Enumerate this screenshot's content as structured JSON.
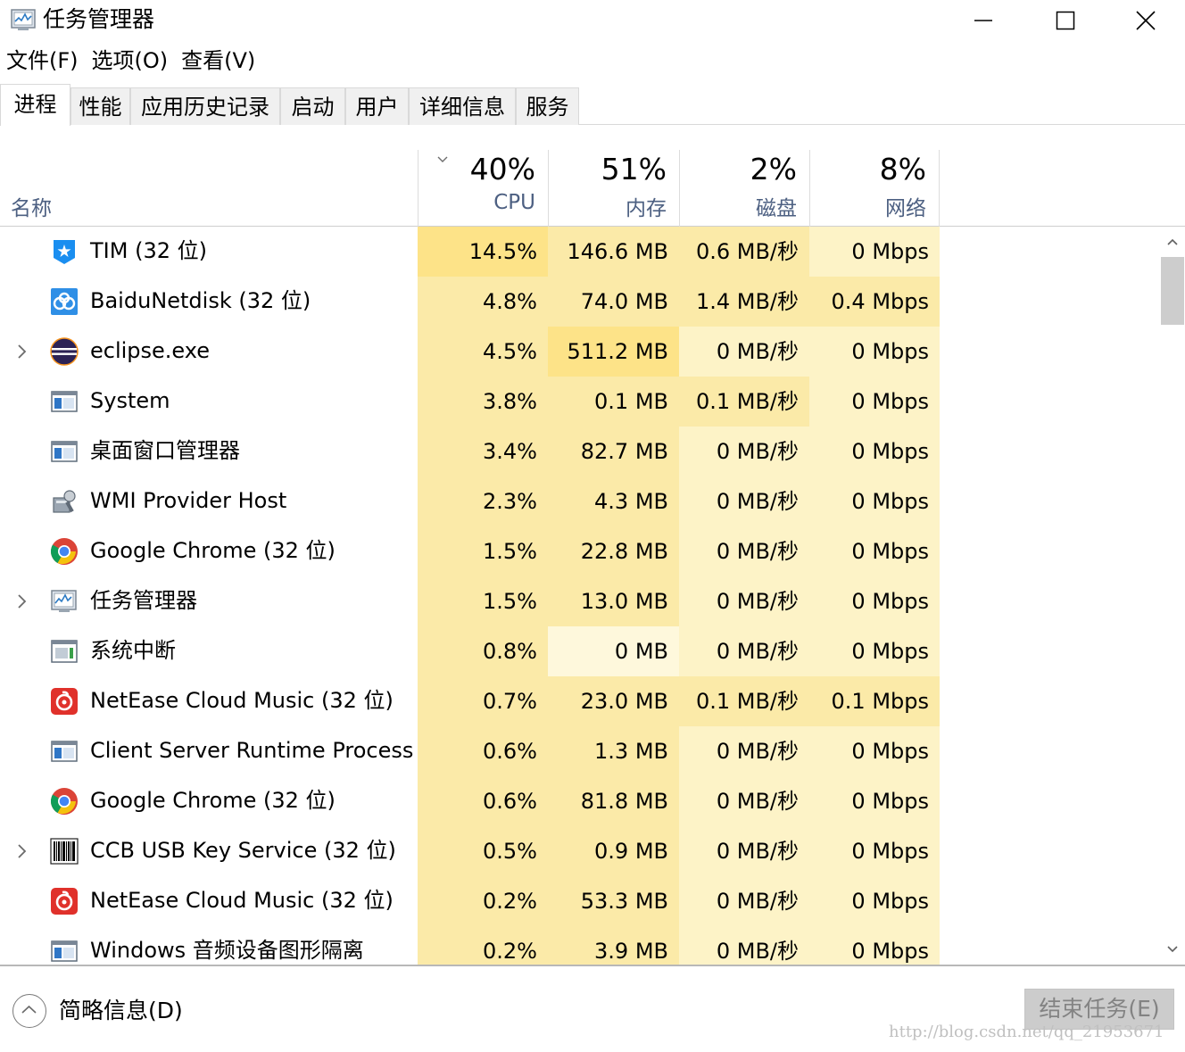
{
  "window": {
    "title": "任务管理器",
    "minimize_icon": "minimize-icon",
    "maximize_icon": "maximize-icon",
    "close_icon": "close-icon"
  },
  "menu": [
    "文件(F)",
    "选项(O)",
    "查看(V)"
  ],
  "tabs": [
    "进程",
    "性能",
    "应用历史记录",
    "启动",
    "用户",
    "详细信息",
    "服务"
  ],
  "active_tab": "进程",
  "columns": {
    "name": "名称",
    "cpu": {
      "percent": "40%",
      "label": "CPU"
    },
    "memory": {
      "percent": "51%",
      "label": "内存"
    },
    "disk": {
      "percent": "2%",
      "label": "磁盘"
    },
    "network": {
      "percent": "8%",
      "label": "网络"
    },
    "sort_column": "CPU"
  },
  "processes": [
    {
      "name": "TIM (32 位)",
      "icon": "tim-icon",
      "expandable": false,
      "cpu": "14.5%",
      "memory": "146.6 MB",
      "disk": "0.6 MB/秒",
      "network": "0 Mbps"
    },
    {
      "name": "BaiduNetdisk (32 位)",
      "icon": "baidu-netdisk-icon",
      "expandable": false,
      "cpu": "4.8%",
      "memory": "74.0 MB",
      "disk": "1.4 MB/秒",
      "network": "0.4 Mbps"
    },
    {
      "name": "eclipse.exe",
      "icon": "eclipse-icon",
      "expandable": true,
      "cpu": "4.5%",
      "memory": "511.2 MB",
      "disk": "0 MB/秒",
      "network": "0 Mbps"
    },
    {
      "name": "System",
      "icon": "system-window-icon",
      "expandable": false,
      "cpu": "3.8%",
      "memory": "0.1 MB",
      "disk": "0.1 MB/秒",
      "network": "0 Mbps"
    },
    {
      "name": "桌面窗口管理器",
      "icon": "system-window-icon",
      "expandable": false,
      "cpu": "3.4%",
      "memory": "82.7 MB",
      "disk": "0 MB/秒",
      "network": "0 Mbps"
    },
    {
      "name": "WMI Provider Host",
      "icon": "wmi-icon",
      "expandable": false,
      "cpu": "2.3%",
      "memory": "4.3 MB",
      "disk": "0 MB/秒",
      "network": "0 Mbps"
    },
    {
      "name": "Google Chrome (32 位)",
      "icon": "chrome-icon",
      "expandable": false,
      "cpu": "1.5%",
      "memory": "22.8 MB",
      "disk": "0 MB/秒",
      "network": "0 Mbps"
    },
    {
      "name": "任务管理器",
      "icon": "task-manager-icon",
      "expandable": true,
      "cpu": "1.5%",
      "memory": "13.0 MB",
      "disk": "0 MB/秒",
      "network": "0 Mbps"
    },
    {
      "name": "系统中断",
      "icon": "interrupt-icon",
      "expandable": false,
      "cpu": "0.8%",
      "memory": "0 MB",
      "disk": "0 MB/秒",
      "network": "0 Mbps"
    },
    {
      "name": "NetEase Cloud Music (32 位)",
      "icon": "netease-music-icon",
      "expandable": false,
      "cpu": "0.7%",
      "memory": "23.0 MB",
      "disk": "0.1 MB/秒",
      "network": "0.1 Mbps"
    },
    {
      "name": "Client Server Runtime Process",
      "icon": "system-window-icon",
      "expandable": false,
      "cpu": "0.6%",
      "memory": "1.3 MB",
      "disk": "0 MB/秒",
      "network": "0 Mbps"
    },
    {
      "name": "Google Chrome (32 位)",
      "icon": "chrome-icon",
      "expandable": false,
      "cpu": "0.6%",
      "memory": "81.8 MB",
      "disk": "0 MB/秒",
      "network": "0 Mbps"
    },
    {
      "name": "CCB USB Key Service (32 位)",
      "icon": "barcode-icon",
      "expandable": true,
      "cpu": "0.5%",
      "memory": "0.9 MB",
      "disk": "0 MB/秒",
      "network": "0 Mbps"
    },
    {
      "name": "NetEase Cloud Music (32 位)",
      "icon": "netease-music-icon",
      "expandable": false,
      "cpu": "0.2%",
      "memory": "53.3 MB",
      "disk": "0 MB/秒",
      "network": "0 Mbps"
    },
    {
      "name": "Windows 音频设备图形隔离",
      "icon": "system-window-icon",
      "expandable": false,
      "cpu": "0.2%",
      "memory": "3.9 MB",
      "disk": "0 MB/秒",
      "network": "0 Mbps"
    }
  ],
  "footer": {
    "fewer_details": "简略信息(D)",
    "end_task": "结束任务(E)",
    "watermark": "http://blog.csdn.net/qq_21953671"
  },
  "colors": {
    "heat_high": "#fde388",
    "heat_mid": "#fbeaa8",
    "heat_low": "#fdf3c7",
    "heat_min": "#fef8dc",
    "header_label": "#4d6082"
  }
}
